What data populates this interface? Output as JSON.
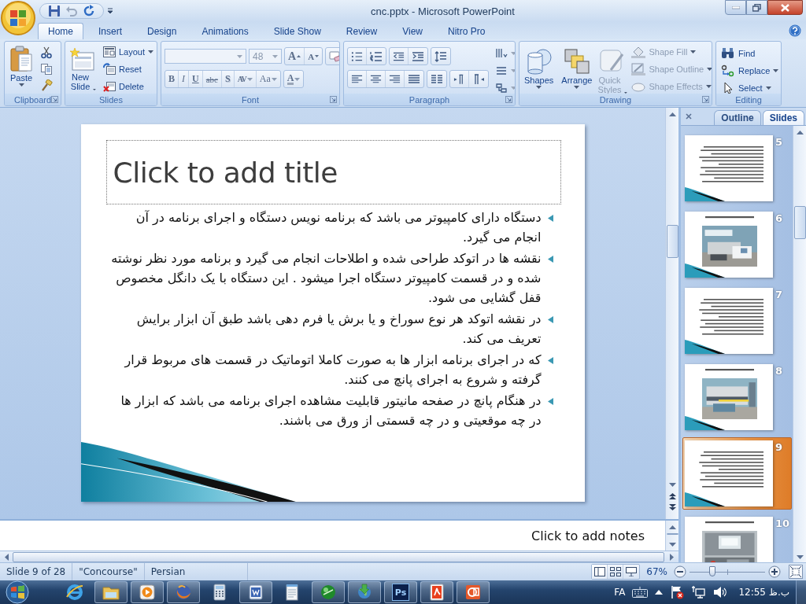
{
  "window": {
    "title": "cnc.pptx - Microsoft PowerPoint"
  },
  "ribbon_tabs": [
    {
      "label": "Home",
      "selected": true
    },
    {
      "label": "Insert",
      "selected": false
    },
    {
      "label": "Design",
      "selected": false
    },
    {
      "label": "Animations",
      "selected": false
    },
    {
      "label": "Slide Show",
      "selected": false
    },
    {
      "label": "Review",
      "selected": false
    },
    {
      "label": "View",
      "selected": false
    },
    {
      "label": "Nitro Pro",
      "selected": false
    }
  ],
  "ribbon_groups": [
    {
      "kind": "clipboard",
      "label": "Clipboard",
      "launcher": true,
      "buttons": [
        {
          "label": "Paste",
          "dropdown": true
        }
      ]
    },
    {
      "kind": "slides",
      "label": "Slides",
      "launcher": false,
      "buttons": [
        {
          "label": "New Slide",
          "dropdown": true
        },
        {
          "label": "Layout",
          "dropdown": true
        },
        {
          "label": "Reset",
          "dropdown": false
        },
        {
          "label": "Delete",
          "dropdown": false
        }
      ]
    },
    {
      "kind": "font",
      "label": "Font",
      "launcher": true,
      "font_size": "48",
      "buttons": [
        {
          "kind": "grow",
          "label": "A"
        },
        {
          "kind": "shrink",
          "label": "A"
        },
        {
          "kind": "bold",
          "label": "B"
        },
        {
          "kind": "italic",
          "label": "I"
        },
        {
          "kind": "underline",
          "label": "U"
        },
        {
          "kind": "strike",
          "label": "abc"
        },
        {
          "kind": "shadow",
          "label": "S"
        },
        {
          "kind": "spacing",
          "label": "AV"
        },
        {
          "kind": "case",
          "label": "Aa"
        },
        {
          "kind": "color",
          "label": "A"
        }
      ]
    },
    {
      "kind": "paragraph",
      "label": "Paragraph",
      "launcher": true
    },
    {
      "kind": "drawing",
      "label": "Drawing",
      "launcher": true,
      "buttons": [
        {
          "label": "Shapes",
          "dropdown": true,
          "disabled": false
        },
        {
          "label": "Arrange",
          "dropdown": true,
          "disabled": false
        },
        {
          "label": "Quick Styles",
          "dropdown": true,
          "disabled": true
        },
        {
          "label": "Shape Fill",
          "dropdown": true,
          "disabled": true
        },
        {
          "label": "Shape Outline",
          "dropdown": true,
          "disabled": true
        },
        {
          "label": "Shape Effects",
          "dropdown": true,
          "disabled": true
        }
      ]
    },
    {
      "kind": "editing",
      "label": "Editing",
      "launcher": false,
      "buttons": [
        {
          "label": "Find",
          "dropdown": false
        },
        {
          "label": "Replace",
          "dropdown": true
        },
        {
          "label": "Select",
          "dropdown": true
        }
      ]
    }
  ],
  "slide": {
    "title_placeholder": "Click to add title",
    "bullets": [
      "دستگاه دارای کامپیوتر می باشد که برنامه نویس دستگاه و اجرای برنامه در آن انجام می گیرد.",
      "نقشه ها در اتوکد طراحی شده و اطلاحات انجام می گیرد و برنامه مورد نظر نوشته شده و در قسمت کامپیوتر دستگاه اجرا میشود . این دستگاه با یک دانگل مخصوص قفل گشایی می شود.",
      "در نقشه اتوکد هر نوع سوراخ و یا برش یا فرم دهی باشد طبق آن ابزار برایش تعریف می کند.",
      "که در اجرای برنامه ابزار ها به صورت کاملا اتوماتیک در قسمت های مربوط قرار گرفته و شروع به اجرای پانچ می کنند.",
      "در هنگام پانچ در صفحه مانیتور قابلیت مشاهده اجرای برنامه می باشد که ابزار ها در چه موقعیتی و در چه قسمتی از ورق می باشند."
    ]
  },
  "notes": {
    "placeholder": "Click to add notes"
  },
  "slides_pane": {
    "tabs": [
      {
        "label": "Outline",
        "selected": false
      },
      {
        "label": "Slides",
        "selected": true
      }
    ],
    "thumbnails": [
      {
        "number": "5",
        "kind": "text",
        "selected": false
      },
      {
        "number": "6",
        "kind": "picture",
        "selected": false
      },
      {
        "number": "7",
        "kind": "text",
        "selected": false
      },
      {
        "number": "8",
        "kind": "picture",
        "selected": false
      },
      {
        "number": "9",
        "kind": "text",
        "selected": true
      },
      {
        "number": "10",
        "kind": "picture",
        "selected": false
      }
    ]
  },
  "status_bar": {
    "slide": "Slide 9 of 28",
    "theme": "\"Concourse\"",
    "language": "Persian",
    "zoom": {
      "reading": "67%",
      "level": 0.3
    }
  },
  "taskbar": {
    "apps": [
      {
        "kind": "browser",
        "running": false
      },
      {
        "kind": "folder",
        "running": true
      },
      {
        "kind": "media",
        "running": true
      },
      {
        "kind": "fox",
        "running": true
      },
      {
        "kind": "calculator",
        "running": false
      },
      {
        "kind": "word",
        "running": true
      },
      {
        "kind": "notepad",
        "running": false
      },
      {
        "kind": "greenball",
        "running": true
      },
      {
        "kind": "globe",
        "running": true
      },
      {
        "running": true,
        "label": "Ps"
      },
      {
        "kind": "reader",
        "running": true
      },
      {
        "kind": "slides",
        "running": true
      }
    ],
    "language": "FA",
    "clock": "ب.ظ 12:55"
  }
}
